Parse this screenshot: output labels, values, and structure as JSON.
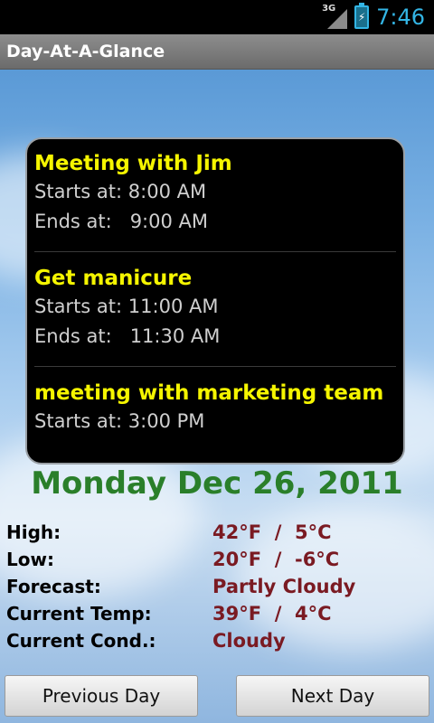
{
  "status_bar": {
    "network": "3G",
    "battery_icon": "battery-charging-icon",
    "signal_icon": "signal-icon",
    "time": "7:46",
    "accent": "#33b5e5"
  },
  "app": {
    "title": "Day-At-A-Glance"
  },
  "events": [
    {
      "title": "Meeting with Jim",
      "starts_label": "Starts at:",
      "starts": "8:00 AM",
      "ends_label": "Ends at:",
      "ends": "9:00 AM"
    },
    {
      "title": "Get manicure",
      "starts_label": "Starts at:",
      "starts": "11:00 AM",
      "ends_label": "Ends at:",
      "ends": "11:30 AM"
    },
    {
      "title": "meeting with marketing team",
      "starts_label": "Starts at:",
      "starts": "3:00 PM"
    }
  ],
  "date": "Monday Dec 26, 2011",
  "weather": {
    "high_label": "High:",
    "high": "42°F  /  5°C",
    "low_label": "Low:",
    "low": "20°F  /  -6°C",
    "forecast_label": "Forecast:",
    "forecast": "Partly Cloudy",
    "current_temp_label": "Current Temp:",
    "current_temp": "39°F  /  4°C",
    "current_cond_label": "Current Cond.:",
    "current_cond": "Cloudy"
  },
  "buttons": {
    "previous": "Previous Day",
    "next": "Next Day"
  },
  "colors": {
    "event_title": "#f5f500",
    "date": "#2a7f2a",
    "weather_value": "#7a1a22"
  }
}
